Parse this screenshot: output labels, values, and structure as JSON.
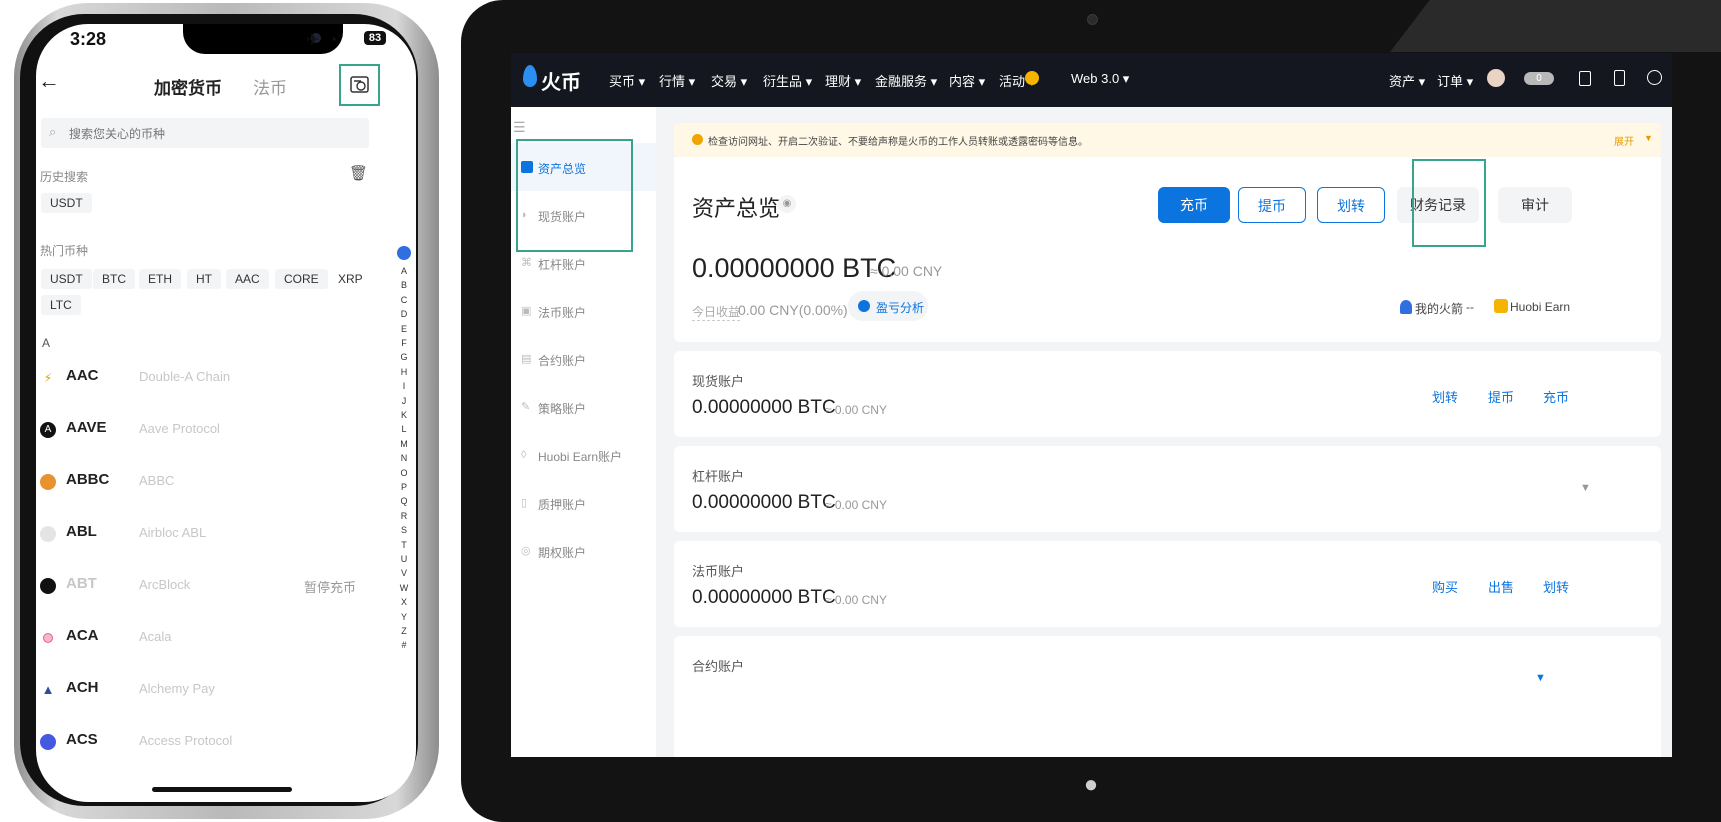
{
  "phone": {
    "status": {
      "time": "3:28",
      "battery": "83"
    },
    "header": {
      "tab_crypto": "加密货币",
      "tab_fiat": "法币"
    },
    "search": {
      "placeholder": "搜索您关心的币种"
    },
    "history": {
      "title": "历史搜索",
      "items": [
        "USDT"
      ]
    },
    "hot": {
      "title": "热门币种",
      "items": [
        "USDT",
        "BTC",
        "ETH",
        "HT",
        "AAC",
        "CORE",
        "XRP",
        "LTC"
      ]
    },
    "section_letter": "A",
    "coins": [
      {
        "symbol": "AAC",
        "name": "Double-A Chain",
        "color": "#d9a400"
      },
      {
        "symbol": "AAVE",
        "name": "Aave Protocol",
        "color": "#111111"
      },
      {
        "symbol": "ABBC",
        "name": "ABBC",
        "color": "#e7922f"
      },
      {
        "symbol": "ABL",
        "name": "Airbloc ABL",
        "color": "#dddddd"
      },
      {
        "symbol": "ABT",
        "name": "ArcBlock",
        "color": "#111111",
        "status": "暂停充币"
      },
      {
        "symbol": "ACA",
        "name": "Acala",
        "color": "#e85a8c"
      },
      {
        "symbol": "ACH",
        "name": "Alchemy Pay",
        "color": "#2f4d9e"
      },
      {
        "symbol": "ACS",
        "name": "Access Protocol",
        "color": "#4458e0"
      }
    ],
    "alphabet": [
      "A",
      "B",
      "C",
      "D",
      "E",
      "F",
      "G",
      "H",
      "I",
      "J",
      "K",
      "L",
      "M",
      "N",
      "O",
      "P",
      "Q",
      "R",
      "S",
      "T",
      "U",
      "V",
      "W",
      "X",
      "Y",
      "Z",
      "#"
    ]
  },
  "web": {
    "logo": "火币",
    "nav": [
      "买币",
      "行情",
      "交易",
      "衍生品",
      "理财",
      "金融服务",
      "内容",
      "活动",
      "Web 3.0"
    ],
    "nav_right": {
      "assets": "资产",
      "orders": "订单",
      "notif_count": "0"
    },
    "sidebar": [
      "资产总览",
      "现货账户",
      "杠杆账户",
      "法币账户",
      "合约账户",
      "策略账户",
      "Huobi Earn账户",
      "质押账户",
      "期权账户"
    ],
    "notice": {
      "text": "检查访问网址、开启二次验证、不要给声称是火币的工作人员转账或透露密码等信息。",
      "expand": "展开"
    },
    "overview": {
      "title": "资产总览",
      "btn_deposit": "充币",
      "btn_withdraw": "提币",
      "btn_transfer": "划转",
      "btn_records": "财务记录",
      "btn_audit": "审计",
      "balance": "0.00000000 BTC",
      "balance_cny": "≈ 0.00 CNY",
      "today_label": "今日收益",
      "today_value": "0.00 CNY(0.00%)",
      "pnl": "盈亏分析",
      "rocket": "我的火箭",
      "rocket_val": "--",
      "earn": "Huobi Earn"
    },
    "accounts": [
      {
        "title": "现货账户",
        "value": "0.00000000 BTC",
        "cny": "≈ 0.00 CNY",
        "actions": [
          "划转",
          "提币",
          "充币"
        ]
      },
      {
        "title": "杠杆账户",
        "value": "0.00000000 BTC",
        "cny": "≈ 0.00 CNY",
        "actions": []
      },
      {
        "title": "法币账户",
        "value": "0.00000000 BTC",
        "cny": "≈ 0.00 CNY",
        "actions": [
          "购买",
          "出售",
          "划转"
        ]
      },
      {
        "title": "合约账户"
      }
    ],
    "colors": {
      "primary": "#0b74de",
      "topbar": "#14171f",
      "highlight": "#39a48c",
      "notice_bg": "#fff8e6"
    }
  }
}
